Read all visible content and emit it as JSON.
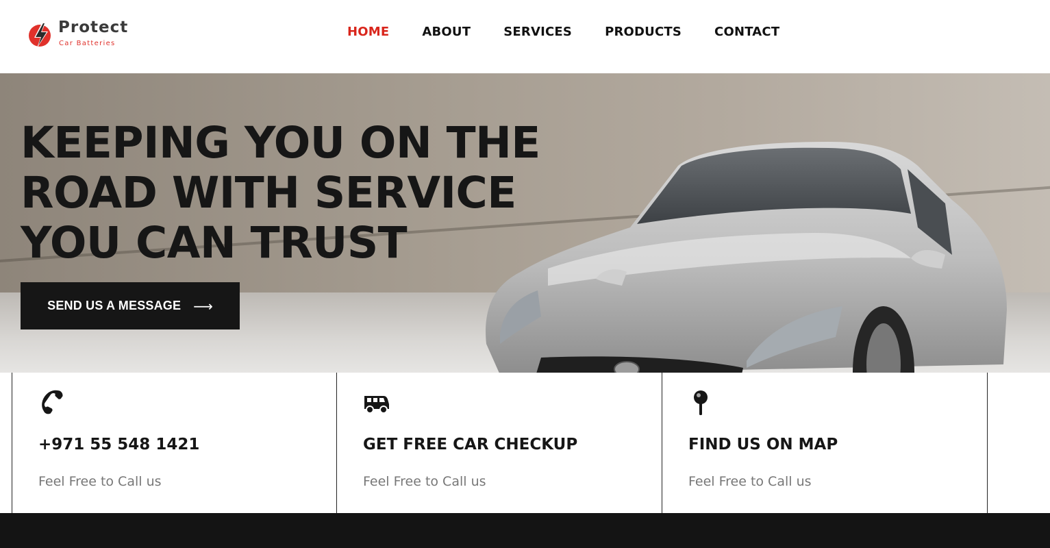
{
  "brand": {
    "name": "Protect",
    "tagline": "Car Batteries",
    "accent": "#d9261c"
  },
  "nav": {
    "items": [
      {
        "label": "HOME",
        "active": true
      },
      {
        "label": "ABOUT",
        "active": false
      },
      {
        "label": "SERVICES",
        "active": false
      },
      {
        "label": "PRODUCTS",
        "active": false
      },
      {
        "label": "CONTACT",
        "active": false
      }
    ]
  },
  "hero": {
    "title_lines": [
      "KEEPING YOU ON THE",
      "ROAD WITH SERVICE",
      "YOU CAN TRUST"
    ],
    "button_label": "SEND US A MESSAGE",
    "button_icon": "arrow-right-icon"
  },
  "cards": [
    {
      "icon": "phone-icon",
      "title": "+971 55 548 1421",
      "subtitle": "Feel Free to Call us"
    },
    {
      "icon": "van-icon",
      "title": "GET FREE CAR CHECKUP",
      "subtitle": "Feel Free to Call us"
    },
    {
      "icon": "map-pin-icon",
      "title": "FIND US ON MAP",
      "subtitle": "Feel Free to Call us"
    }
  ],
  "colors": {
    "dark": "#161616",
    "muted_text": "#777777",
    "footer": "#141414"
  }
}
